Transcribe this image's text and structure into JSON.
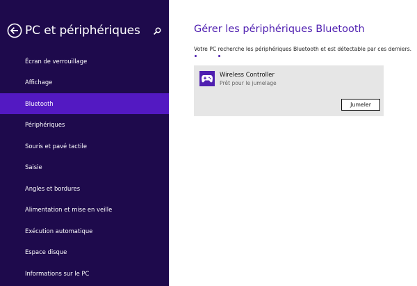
{
  "sidebar": {
    "title": "PC et périphériques",
    "back_icon": "back-arrow-circle-icon",
    "search_icon": "search-icon",
    "items": [
      {
        "label": "Écran de verrouillage",
        "active": false
      },
      {
        "label": "Affichage",
        "active": false
      },
      {
        "label": "Bluetooth",
        "active": true
      },
      {
        "label": "Périphériques",
        "active": false
      },
      {
        "label": "Souris et pavé tactile",
        "active": false
      },
      {
        "label": "Saisie",
        "active": false
      },
      {
        "label": "Angles et bordures",
        "active": false
      },
      {
        "label": "Alimentation et mise en veille",
        "active": false
      },
      {
        "label": "Exécution automatique",
        "active": false
      },
      {
        "label": "Espace disque",
        "active": false
      },
      {
        "label": "Informations sur le PC",
        "active": false
      }
    ]
  },
  "main": {
    "title": "Gérer les périphériques Bluetooth",
    "description": "Votre PC recherche les périphériques Bluetooth et est détectable par ces derniers.",
    "device": {
      "icon": "gamepad-icon",
      "name": "Wireless Controller",
      "status": "Prêt pour le jumelage",
      "pair_label": "Jumeler"
    }
  },
  "colors": {
    "sidebar_bg": "#1e0a4c",
    "active_item": "#5319c2",
    "accent": "#4f1fb0",
    "card_bg": "#e6e6e6"
  }
}
